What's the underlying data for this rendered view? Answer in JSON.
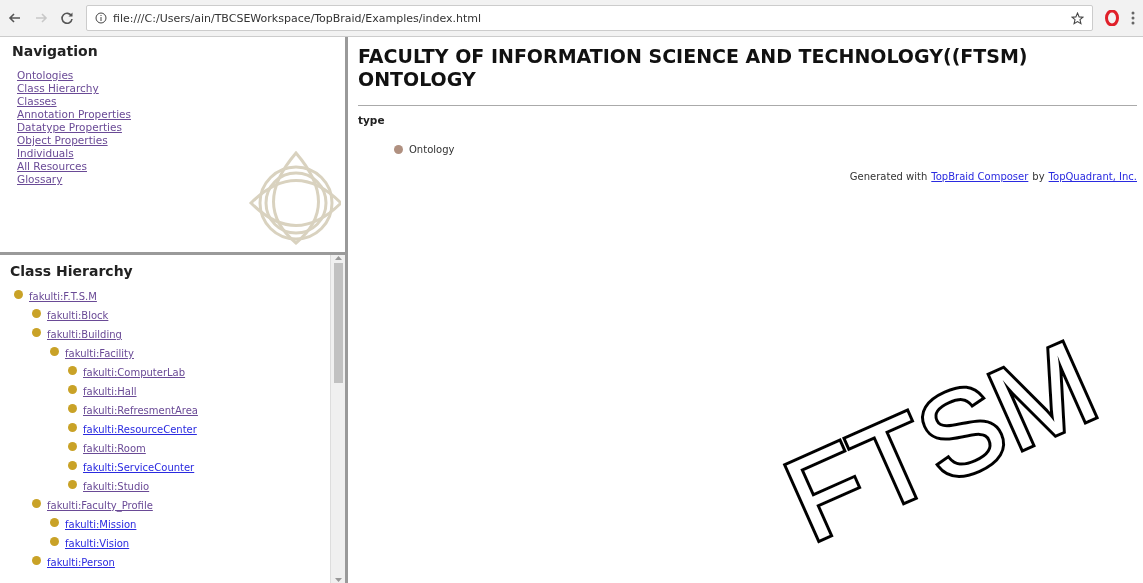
{
  "browser": {
    "url": "file:///C:/Users/ain/TBCSEWorkspace/TopBraid/Examples/index.html",
    "forward_disabled": true
  },
  "navigation": {
    "title": "Navigation",
    "links": [
      {
        "label": "Ontologies",
        "visited": true
      },
      {
        "label": "Class Hierarchy",
        "visited": true
      },
      {
        "label": "Classes",
        "visited": true
      },
      {
        "label": "Annotation Properties",
        "visited": true
      },
      {
        "label": "Datatype Properties",
        "visited": true
      },
      {
        "label": "Object Properties",
        "visited": true
      },
      {
        "label": "Individuals",
        "visited": true
      },
      {
        "label": "All Resources",
        "visited": true
      },
      {
        "label": "Glossary",
        "visited": true
      }
    ]
  },
  "class_hierarchy": {
    "title": "Class Hierarchy",
    "items": [
      {
        "label": "fakulti:F.T.S.M",
        "visited": true,
        "children": [
          {
            "label": "fakulti:Block",
            "visited": true
          },
          {
            "label": "fakulti:Building",
            "visited": true,
            "children": [
              {
                "label": "fakulti:Facility",
                "visited": true,
                "children": [
                  {
                    "label": "fakulti:ComputerLab",
                    "visited": true
                  },
                  {
                    "label": "fakulti:Hall",
                    "visited": true
                  },
                  {
                    "label": "fakulti:RefresmentArea",
                    "visited": true
                  },
                  {
                    "label": "fakulti:ResourceCenter",
                    "visited": false
                  },
                  {
                    "label": "fakulti:Room",
                    "visited": true
                  },
                  {
                    "label": "fakulti:ServiceCounter",
                    "visited": false
                  },
                  {
                    "label": "fakulti:Studio",
                    "visited": true
                  }
                ]
              }
            ]
          },
          {
            "label": "fakulti:Faculty_Profile",
            "visited": true,
            "children": [
              {
                "label": "fakulti:Mission",
                "visited": false
              },
              {
                "label": "fakulti:Vision",
                "visited": false
              }
            ]
          },
          {
            "label": "fakulti:Person",
            "visited": false
          }
        ]
      }
    ]
  },
  "main": {
    "title": "FACULTY OF INFORMATION SCIENCE AND TECHNOLOGY((FTSM) ONTOLOGY",
    "property": "type",
    "values": [
      "Ontology"
    ],
    "footer": {
      "prefix": "Generated with",
      "link1": "TopBraid Composer",
      "middle": "by",
      "link2": "TopQuadrant, Inc."
    }
  },
  "overlay_text": "FTSM"
}
